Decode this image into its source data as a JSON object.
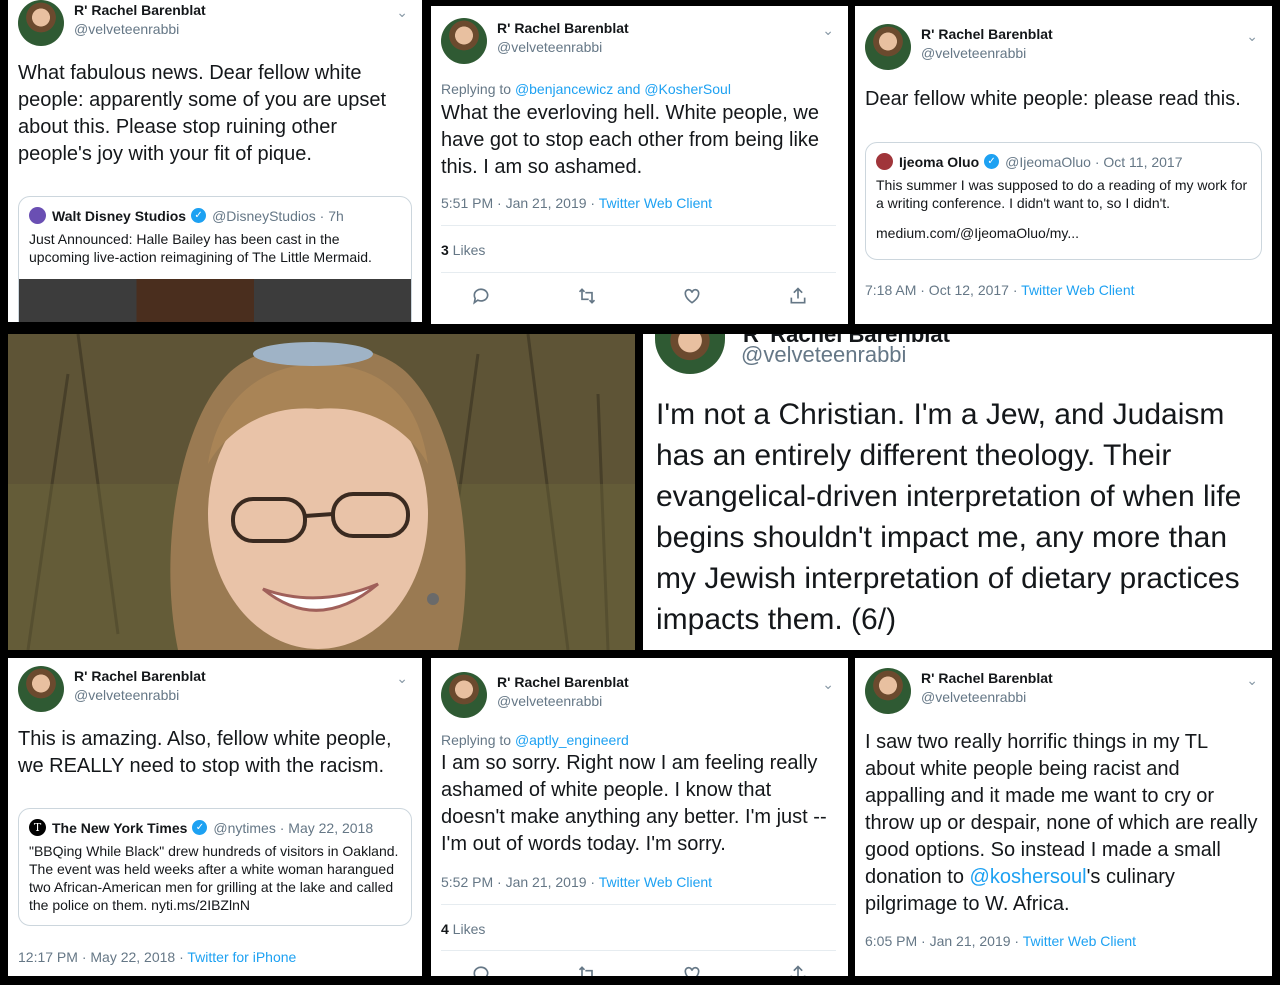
{
  "author": {
    "name": "R' Rachel Barenblat",
    "handle": "@velveteenrabbi"
  },
  "tweet1": {
    "text": "What fabulous news. Dear fellow white people: apparently some of you are upset about this. Please stop ruining other people's joy with your fit of pique.",
    "quote": {
      "name": "Walt Disney Studios",
      "handle": "@DisneyStudios · 7h",
      "text": "Just Announced: Halle Bailey has been cast in the upcoming live-action reimagining of The Little Mermaid."
    }
  },
  "tweet2": {
    "reply_prefix": "Replying to ",
    "reply_to": "@benjancewicz and @KosherSoul",
    "text": "What the everloving hell. White people, we have got to stop each other from being like this. I am so ashamed.",
    "time": "5:51 PM · Jan 21, 2019 · ",
    "client": "Twitter Web Client",
    "likes_count": "3",
    "likes_label": " Likes"
  },
  "tweet3": {
    "text": "Dear fellow white people: please read this.",
    "quote": {
      "name": "Ijeoma Oluo",
      "handle": "@IjeomaOluo · Oct 11, 2017",
      "text": "This summer I was supposed to do a reading of my work for a writing conference. I didn't want to, so I didn't.",
      "link": "medium.com/@IjeomaOluo/my..."
    },
    "time": "7:18 AM · Oct 12, 2017 · ",
    "client": "Twitter Web Client"
  },
  "tweet4": {
    "name_cut": "R' Rachel Barenblat",
    "handle": "@velveteenrabbi",
    "text": "I'm not a Christian. I'm a Jew, and Judaism has an entirely different theology. Their evangelical-driven interpretation of when life begins shouldn't impact me, any more than my Jewish interpretation of dietary practices impacts them. (6/)"
  },
  "tweet5": {
    "text": "This is amazing. Also, fellow white people, we REALLY need to stop with the racism.",
    "quote": {
      "name": "The New York Times",
      "handle": "@nytimes · May 22, 2018",
      "text": "\"BBQing While Black\" drew hundreds of visitors in Oakland. The event was held weeks after a white woman harangued two African-American men for grilling at the lake and called the police on them. nyti.ms/2IBZlnN"
    },
    "time": "12:17 PM · May 22, 2018 · ",
    "client": "Twitter for iPhone"
  },
  "tweet6": {
    "reply_prefix": "Replying to ",
    "reply_to": "@aptly_engineerd",
    "text": "I am so sorry. Right now I am feeling really ashamed of white people. I know that doesn't make anything any better. I'm just -- I'm out of words today. I'm sorry.",
    "time": "5:52 PM · Jan 21, 2019 · ",
    "client": "Twitter Web Client",
    "likes_count": "4",
    "likes_label": " Likes"
  },
  "tweet7": {
    "text_a": "I saw two really horrific things in my TL about white people being racist and appalling and it made me want to cry or throw up or despair, none of which are really good options. So instead I made a small donation to ",
    "mention": "@koshersoul",
    "text_b": "'s culinary pilgrimage to W. Africa.",
    "time": "6:05 PM · Jan 21, 2019 · ",
    "client": "Twitter Web Client"
  },
  "colors": {
    "link": "#1da1f2",
    "gray": "#657786",
    "text": "#14171a",
    "border": "#ccd6dd"
  }
}
